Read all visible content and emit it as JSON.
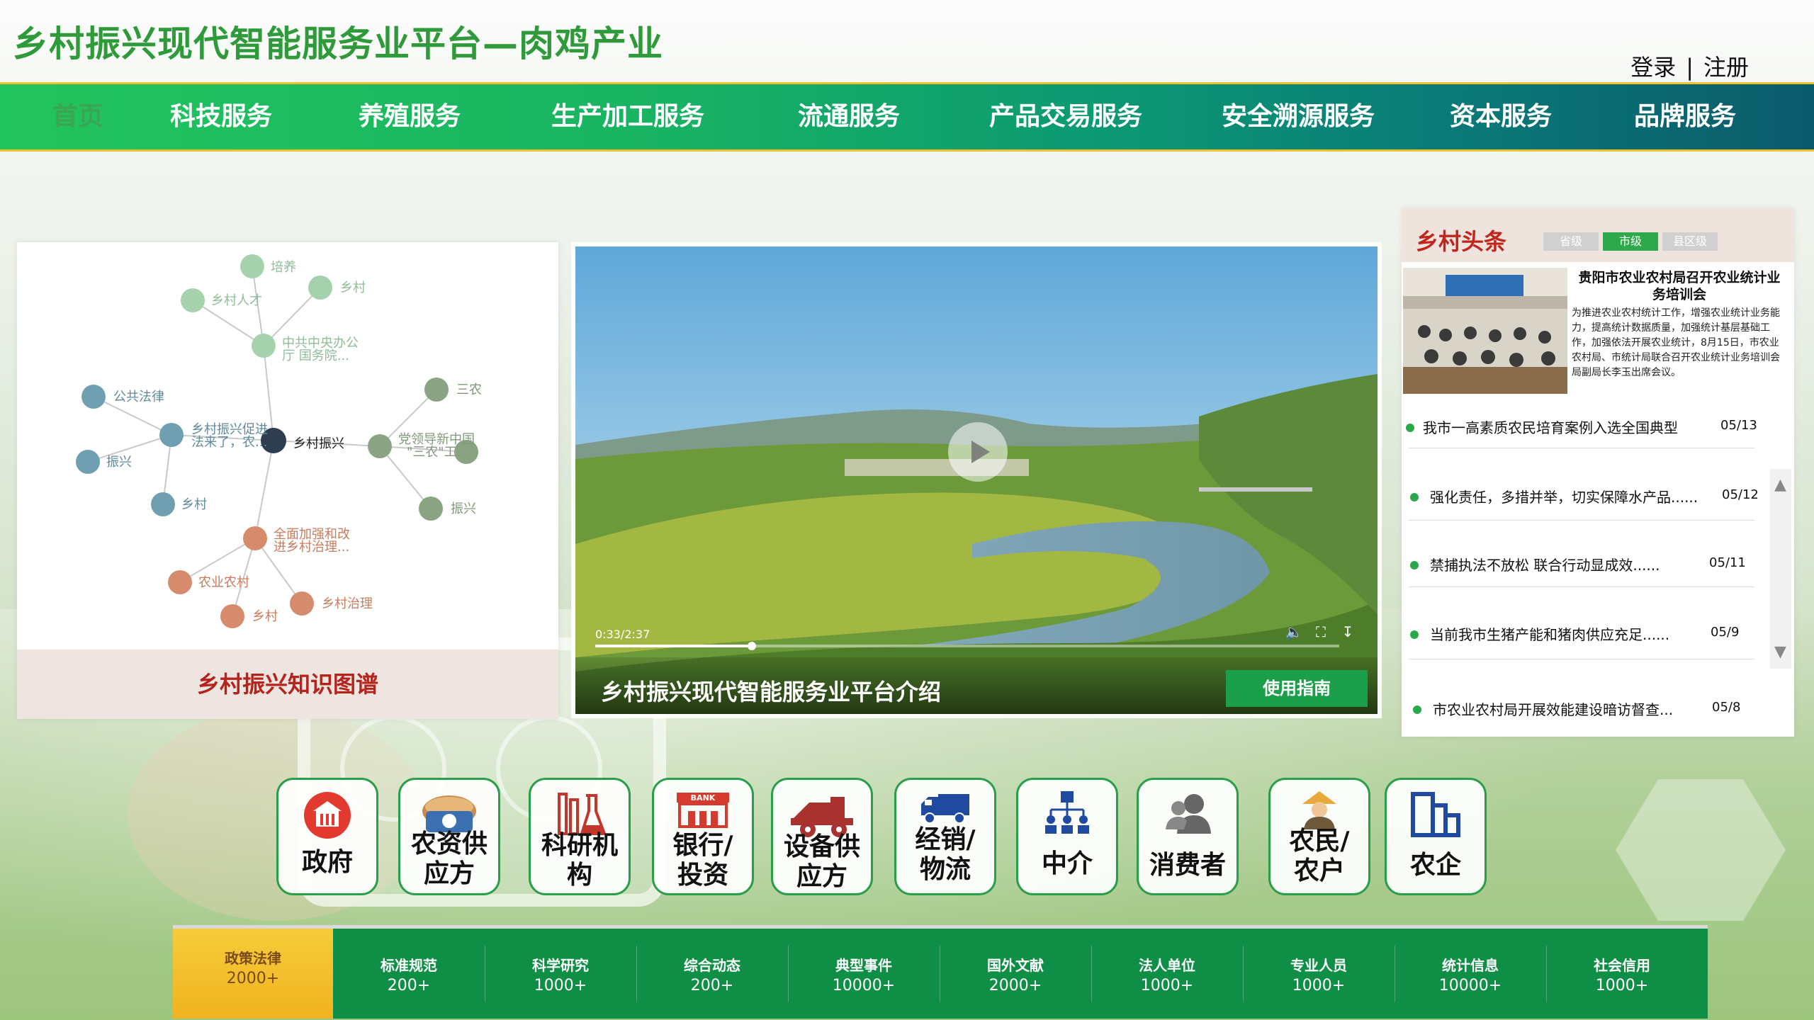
{
  "header": {
    "title": "乡村振兴现代智能服务业平台—肉鸡产业",
    "login": "登录",
    "separator": "|",
    "register": "注册"
  },
  "nav": [
    {
      "label": "首页",
      "active": true
    },
    {
      "label": "科技服务"
    },
    {
      "label": "养殖服务"
    },
    {
      "label": "生产加工服务"
    },
    {
      "label": "流通服务"
    },
    {
      "label": "产品交易服务"
    },
    {
      "label": "安全溯源服务"
    },
    {
      "label": "资本服务"
    },
    {
      "label": "品牌服务"
    }
  ],
  "graph": {
    "center": "乡村振兴",
    "nodes": [
      "培养",
      "乡村",
      "乡村人才",
      "中共中央办公",
      "厅 国务院...",
      "公共法律",
      "乡村振兴促进",
      "法来了，农...",
      "振兴",
      "乡村",
      "三农",
      "党领导新中国",
      "\"三农\"工...",
      "振兴",
      "全面加强和改",
      "进乡村治理...",
      "农业农村",
      "乡村治理",
      "乡村"
    ],
    "caption": "乡村振兴知识图谱",
    "colors": {
      "green": "#8fc29c",
      "blue": "#6f9fb0",
      "olive": "#8aa483",
      "orange": "#d58b6c",
      "center": "#2e3d4f"
    }
  },
  "video": {
    "time": "0:33/2:37",
    "progress": 0.21,
    "title": "乡村振兴现代智能服务业平台介绍",
    "guide_button": "使用指南",
    "icons": [
      "play-icon",
      "volume-icon",
      "fullscreen-icon",
      "download-icon"
    ]
  },
  "news": {
    "title": "乡村头条",
    "tabs": [
      {
        "label": "省级"
      },
      {
        "label": "市级",
        "active": true
      },
      {
        "label": "县区级"
      }
    ],
    "featured": {
      "title": "贵阳市农业农村局召开农业统计业务培训会",
      "body": "为推进农业农村统计工作，增强农业统计业务能力，提高统计数据质量，加强统计基层基础工作，加强依法开展农业统计，8月15日，市农业农村局、市统计局联合召开农业统计业务培训会局副局长李玉出席会议。"
    },
    "items": [
      {
        "text": "我市一高素质农民培育案例入选全国典型",
        "date": "05/13"
      },
      {
        "text": "强化责任，多措并举，切实保障水产品......",
        "date": "05/12"
      },
      {
        "text": "禁捕执法不放松 联合行动显成效......",
        "date": "05/11"
      },
      {
        "text": "当前我市生猪产能和猪肉供应充足......",
        "date": "05/9"
      },
      {
        "text": "市农业农村局开展效能建设暗访督查...",
        "date": "05/8"
      }
    ]
  },
  "categories": [
    {
      "line1": "政府",
      "line2": "",
      "icon": "government-icon"
    },
    {
      "line1": "农资供",
      "line2": "应方",
      "icon": "seed-supply-icon"
    },
    {
      "line1": "科研机",
      "line2": "构",
      "icon": "lab-flask-icon"
    },
    {
      "line1": "银行/",
      "line2": "投资",
      "icon": "bank-icon"
    },
    {
      "line1": "设备供",
      "line2": "应方",
      "icon": "harvester-icon"
    },
    {
      "line1": "经销/",
      "line2": "物流",
      "icon": "truck-icon"
    },
    {
      "line1": "中介",
      "line2": "",
      "icon": "org-chart-icon"
    },
    {
      "line1": "消费者",
      "line2": "",
      "icon": "consumer-icon"
    },
    {
      "line1": "农民/",
      "line2": "农户",
      "icon": "farmer-icon"
    },
    {
      "line1": "农企",
      "line2": "",
      "icon": "enterprise-icon"
    }
  ],
  "bank_sign": "BANK",
  "stats": [
    {
      "label": "政策法律",
      "value": "2000+",
      "active": true
    },
    {
      "label": "标准规范",
      "value": "200+"
    },
    {
      "label": "科学研究",
      "value": "1000+"
    },
    {
      "label": "综合动态",
      "value": "200+"
    },
    {
      "label": "典型事件",
      "value": "10000+"
    },
    {
      "label": "国外文献",
      "value": "2000+"
    },
    {
      "label": "法人单位",
      "value": "1000+"
    },
    {
      "label": "专业人员",
      "value": "1000+"
    },
    {
      "label": "统计信息",
      "value": "10000+"
    },
    {
      "label": "社会信用",
      "value": "1000+"
    }
  ]
}
